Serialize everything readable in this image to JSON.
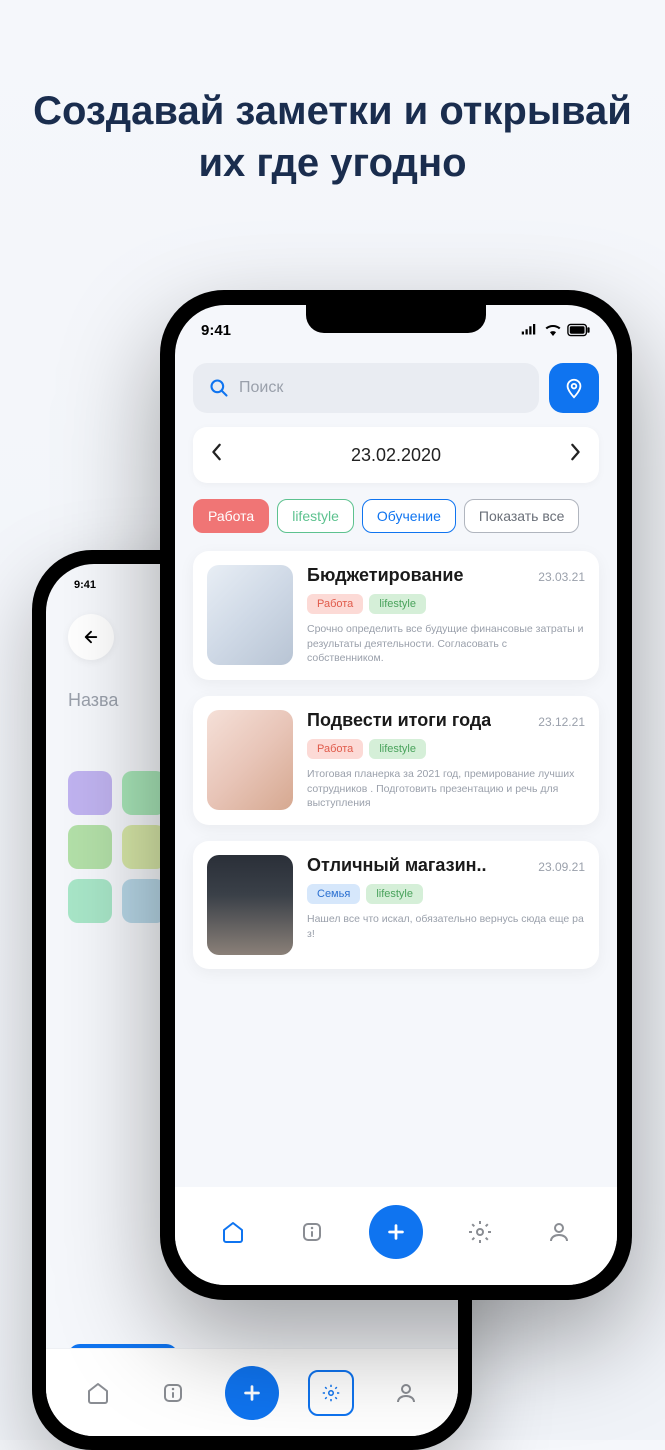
{
  "headline": "Создавай заметки  и открывай их где угодно",
  "status_time": "9:41",
  "search": {
    "placeholder": "Поиск"
  },
  "date_picker": {
    "date": "23.02.2020"
  },
  "chips": [
    {
      "label": "Работа",
      "style": "active"
    },
    {
      "label": "lifestyle",
      "style": "green"
    },
    {
      "label": "Обучение",
      "style": "blue"
    },
    {
      "label": "Показать все",
      "style": "gray"
    }
  ],
  "notes": [
    {
      "title": "Бюджетирование",
      "date": "23.03.21",
      "tags": [
        {
          "label": "Работа",
          "style": "work"
        },
        {
          "label": "lifestyle",
          "style": "life"
        }
      ],
      "desc": "Срочно определить все будущие финансовые затраты и результаты деятельности. Согласовать с собственником.",
      "thumb_bg": "linear-gradient(135deg,#e8eef5 0%,#cfd9e6 50%,#b8c4d4 100%)"
    },
    {
      "title": "Подвести итоги года",
      "date": "23.12.21",
      "tags": [
        {
          "label": "Работа",
          "style": "work"
        },
        {
          "label": "lifestyle",
          "style": "life"
        }
      ],
      "desc": "Итоговая планерка за 2021 год, премирование лучших сотрудников . Подготовить презентацию и речь для выступления",
      "thumb_bg": "linear-gradient(135deg,#f5e0d8 0%,#e8c5b8 50%,#d6a890 100%)"
    },
    {
      "title": "Отличный магазин..",
      "date": "23.09.21",
      "tags": [
        {
          "label": "Семья",
          "style": "family"
        },
        {
          "label": "lifestyle",
          "style": "life"
        }
      ],
      "desc": "Нашел все что искал, обязательно вернусь сюда еще ра з!",
      "thumb_bg": "linear-gradient(180deg,#2a2f38 0%,#3a4048 40%,#8a8078 100%)"
    }
  ],
  "back_phone": {
    "status_time": "9:41",
    "label": "Назва",
    "colors": [
      "#c0b3f0",
      "#a8e6b8",
      "#b3e0a8",
      "#d8e8a8",
      "#a8e6c8",
      "#b8d8e8"
    ]
  }
}
